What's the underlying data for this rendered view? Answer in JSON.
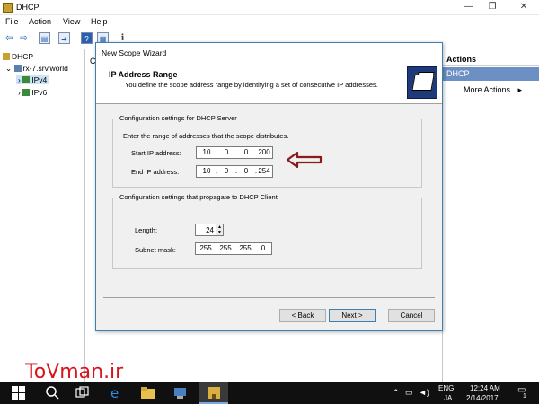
{
  "window": {
    "title": "DHCP",
    "min": "—",
    "max": "❐",
    "close": "✕"
  },
  "menu": {
    "file": "File",
    "action": "Action",
    "view": "View",
    "help": "Help"
  },
  "tree": {
    "root": "DHCP",
    "server": "rx-7.srv.world",
    "ipv4": "IPv4",
    "ipv6": "IPv6"
  },
  "middle": {
    "header_letter": "C"
  },
  "actions": {
    "header": "Actions",
    "section": "DHCP",
    "more": "More Actions"
  },
  "wizard": {
    "title": "New Scope Wizard",
    "heading": "IP Address Range",
    "description": "You define the scope address range by identifying a set of consecutive IP addresses.",
    "server_group": {
      "legend": "Configuration settings for DHCP Server",
      "instruction": "Enter the range of addresses that the scope distributes.",
      "start_label": "Start IP address:",
      "start_ip": [
        "10",
        "0",
        "0",
        "200"
      ],
      "end_label": "End IP address:",
      "end_ip": [
        "10",
        "0",
        "0",
        "254"
      ]
    },
    "client_group": {
      "legend": "Configuration settings that propagate to DHCP Client",
      "length_label": "Length:",
      "length_value": "24",
      "mask_label": "Subnet mask:",
      "mask": [
        "255",
        "255",
        "255",
        "0"
      ]
    },
    "buttons": {
      "back": "< Back",
      "next": "Next >",
      "cancel": "Cancel"
    }
  },
  "watermark": "ToVman.ir",
  "taskbar": {
    "lang": "ENG",
    "ime": "JA",
    "time": "12:24 AM",
    "date": "2/14/2017",
    "notif": "1"
  },
  "colors": {
    "accent": "#3c7fb1",
    "annotation_arrow": "#8b1a1a",
    "watermark": "#d8141c"
  }
}
